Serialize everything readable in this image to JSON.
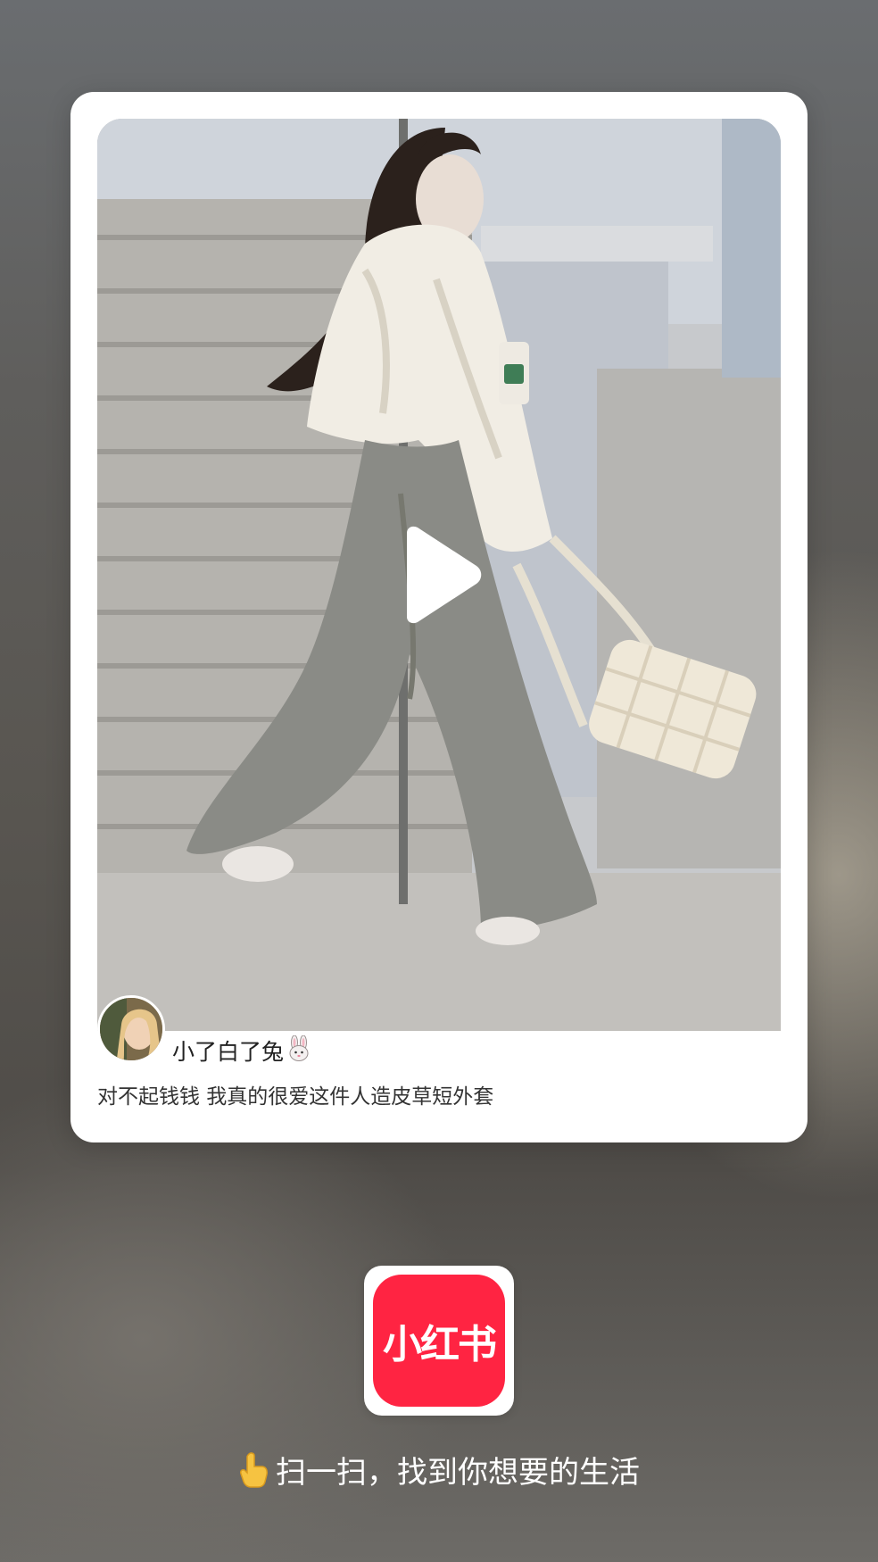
{
  "post": {
    "author_name": "小了白了兔",
    "author_emoji": "rabbit-icon",
    "caption": "对不起钱钱 我真的很爱这件人造皮草短外套",
    "media_type": "video"
  },
  "app": {
    "logo_text": "小红书",
    "brand_color": "#ff2442"
  },
  "footer": {
    "hand_emoji": "pointing-hand-icon",
    "tip": "扫一扫，找到你想要的生活"
  }
}
